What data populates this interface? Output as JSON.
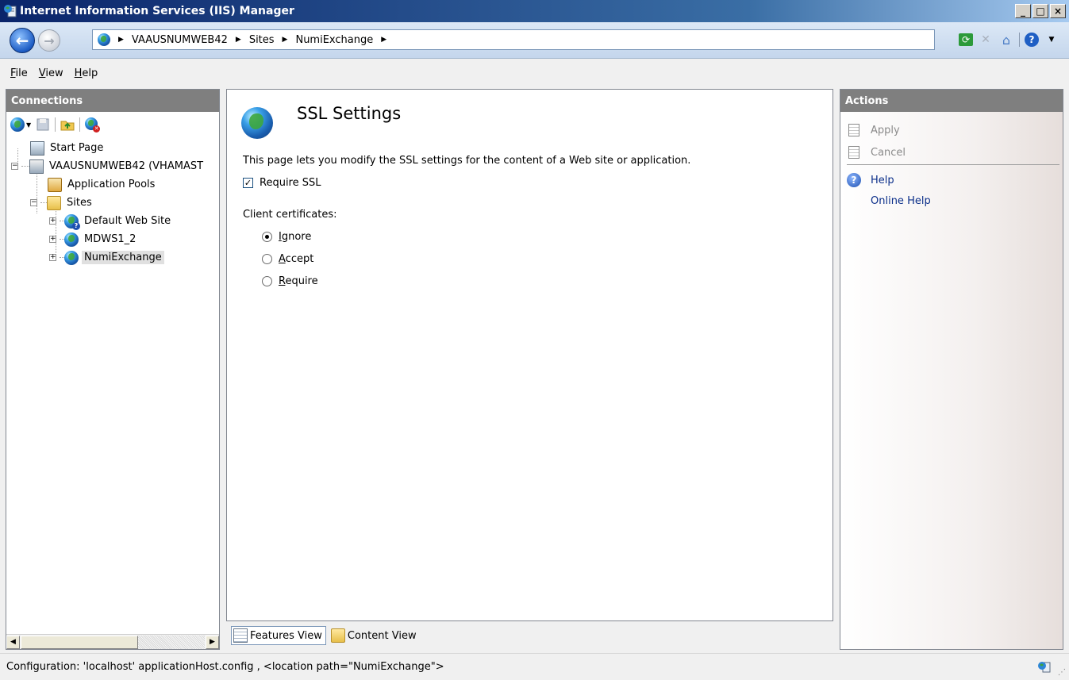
{
  "window": {
    "title": "Internet Information Services (IIS) Manager",
    "controls": {
      "minimize": "_",
      "maximize": "□",
      "close": "×"
    }
  },
  "address_bar": {
    "breadcrumbs": [
      "VAAUSNUMWEB42",
      "Sites",
      "NumiExchange"
    ],
    "icons": [
      "back-icon",
      "forward-icon",
      "refresh-icon",
      "stop-icon",
      "home-icon",
      "help-icon"
    ]
  },
  "menu": [
    {
      "label": "File"
    },
    {
      "label": "View"
    },
    {
      "label": "Help"
    }
  ],
  "connections": {
    "header": "Connections",
    "tree": {
      "start_page": "Start Page",
      "server": "VAAUSNUMWEB42 (VHAMAST",
      "app_pools": "Application Pools",
      "sites": "Sites",
      "site_default": "Default Web Site",
      "site_mdws": "MDWS1_2",
      "site_numi": "NumiExchange"
    },
    "selected": "NumiExchange"
  },
  "feature": {
    "title": "SSL Settings",
    "description": "This page lets you modify the SSL settings for the content of a Web site or application.",
    "require_ssl_label": "Require SSL",
    "require_ssl_checked": true,
    "client_certificates_label": "Client certificates:",
    "client_cert_options": [
      {
        "label": "Ignore",
        "checked": true
      },
      {
        "label": "Accept",
        "checked": false
      },
      {
        "label": "Require",
        "checked": false
      }
    ]
  },
  "view_tabs": {
    "features_view": "Features View",
    "content_view": "Content View",
    "active": "Features View"
  },
  "actions": {
    "header": "Actions",
    "apply": "Apply",
    "cancel": "Cancel",
    "help": "Help",
    "online_help": "Online Help"
  },
  "status": {
    "text": "Configuration: 'localhost' applicationHost.config , <location path=\"NumiExchange\">"
  },
  "colors": {
    "titlebar_start": "#0a246a",
    "pane_header": "#7f7f7f",
    "link": "#0b2f8a"
  }
}
